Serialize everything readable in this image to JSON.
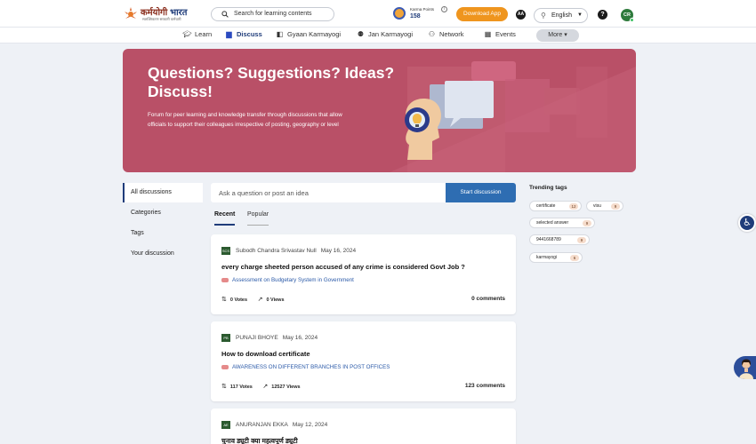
{
  "header": {
    "logo_primary": "कर्मयोगी",
    "logo_secondary": "भारत",
    "logo_tagline": "सशक्तिकरण सरकारी कर्मचारी",
    "search_placeholder": "Search for learning contents",
    "karma_label": "Karma Points",
    "karma_value": "158",
    "download_label": "Download App",
    "font_size_label": "AA",
    "language": "English",
    "help_label": "?",
    "user_initials": "CR"
  },
  "nav": {
    "items": [
      {
        "label": "Learn",
        "icon": "graduation-cap-icon"
      },
      {
        "label": "Discuss",
        "icon": "chat-icon",
        "active": true
      },
      {
        "label": "Gyaan Karmayogi",
        "icon": "book-icon"
      },
      {
        "label": "Jan Karmayogi",
        "icon": "people-icon"
      },
      {
        "label": "Network",
        "icon": "network-icon"
      },
      {
        "label": "Events",
        "icon": "calendar-icon"
      }
    ],
    "more_label": "More"
  },
  "banner": {
    "title": "Questions? Suggestions? Ideas? Discuss!",
    "description": "Forum for peer learning and knowledge transfer through discussions that allow officials to support their colleagues irrespective of posting, geography or level"
  },
  "sidebar": {
    "items": [
      {
        "label": "All discussions",
        "active": true
      },
      {
        "label": "Categories"
      },
      {
        "label": "Tags"
      },
      {
        "label": "Your discussion"
      }
    ]
  },
  "ask": {
    "placeholder": "Ask a question or post an idea",
    "button": "Start discussion"
  },
  "tabs": {
    "recent": "Recent",
    "popular": "Popular"
  },
  "posts": [
    {
      "initials": "SCS",
      "author": "Subodh Chandra Srivastav Null",
      "date": "May 16, 2024",
      "title": "every charge sheeted person accused of any crime is considered Govt Job ?",
      "category": "Assessment on Budgetary System in Government",
      "votes": "0 Votes",
      "views": "0 Views",
      "comments": "0 comments"
    },
    {
      "initials": "PB",
      "author": "PUNAJI BHOYE",
      "date": "May 16, 2024",
      "title": "How to download certificate",
      "category": "AWARENESS ON DIFFERENT BRANCHES IN POST OFFICES",
      "votes": "117 Votes",
      "views": "12527 Views",
      "comments": "123 comments"
    },
    {
      "initials": "AE",
      "author": "ANURANJAN EKKA",
      "date": "May 12, 2024",
      "title": "चुनाव ड्यूटी क्या महत्वपूर्ण ड्यूटी"
    }
  ],
  "trending": {
    "title": "Trending tags",
    "tags": [
      {
        "label": "certificate",
        "count": "12"
      },
      {
        "label": "visu",
        "count": "9"
      },
      {
        "label": "selected answer",
        "count": "9"
      },
      {
        "label": "9441668789",
        "count": "9"
      },
      {
        "label": "karmayogi",
        "count": "6"
      }
    ]
  },
  "colors": {
    "brand": "#1f3c7a",
    "banner": "#b95067",
    "download": "#ef951e",
    "primary_button": "#2e6db2"
  }
}
